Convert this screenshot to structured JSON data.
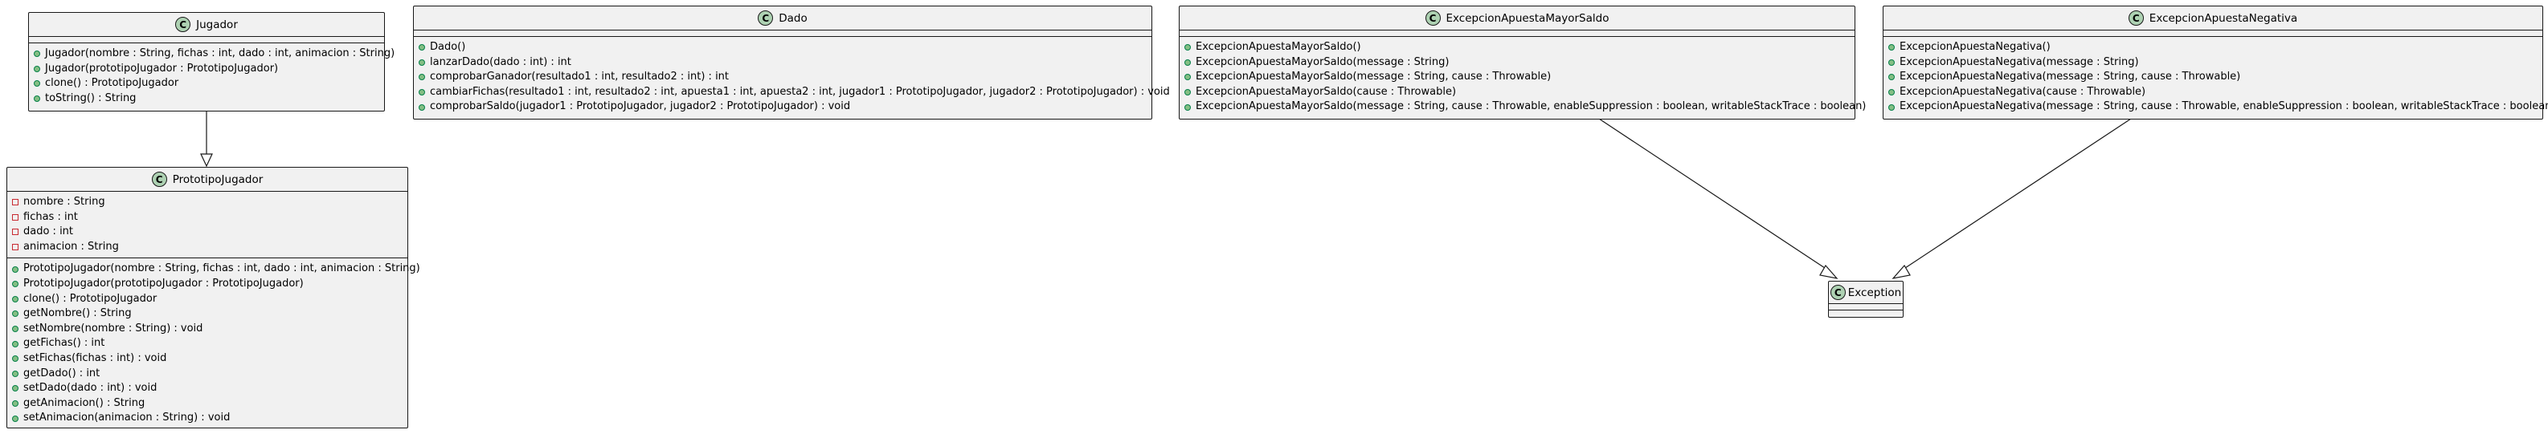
{
  "diagram": {
    "classes": {
      "jugador": {
        "name": "Jugador",
        "stereotype_letter": "C",
        "fields": [],
        "methods": [
          {
            "vis": "public",
            "text": "Jugador(nombre : String, fichas : int, dado : int, animacion : String)"
          },
          {
            "vis": "public",
            "text": "Jugador(prototipoJugador : PrototipoJugador)"
          },
          {
            "vis": "public",
            "text": "clone() : PrototipoJugador"
          },
          {
            "vis": "public",
            "text": "toString() : String"
          }
        ]
      },
      "prototipo": {
        "name": "PrototipoJugador",
        "stereotype_letter": "C",
        "fields": [
          {
            "vis": "private",
            "text": "nombre : String"
          },
          {
            "vis": "private",
            "text": "fichas : int"
          },
          {
            "vis": "private",
            "text": "dado : int"
          },
          {
            "vis": "private",
            "text": "animacion : String"
          }
        ],
        "methods": [
          {
            "vis": "public",
            "text": "PrototipoJugador(nombre : String, fichas : int, dado : int, animacion : String)"
          },
          {
            "vis": "public",
            "text": "PrototipoJugador(prototipoJugador : PrototipoJugador)"
          },
          {
            "vis": "public",
            "text": "clone() : PrototipoJugador"
          },
          {
            "vis": "public",
            "text": "getNombre() : String"
          },
          {
            "vis": "public",
            "text": "setNombre(nombre : String) : void"
          },
          {
            "vis": "public",
            "text": "getFichas() : int"
          },
          {
            "vis": "public",
            "text": "setFichas(fichas : int) : void"
          },
          {
            "vis": "public",
            "text": "getDado() : int"
          },
          {
            "vis": "public",
            "text": "setDado(dado : int) : void"
          },
          {
            "vis": "public",
            "text": "getAnimacion() : String"
          },
          {
            "vis": "public",
            "text": "setAnimacion(animacion : String) : void"
          }
        ]
      },
      "dado": {
        "name": "Dado",
        "stereotype_letter": "C",
        "fields": [],
        "methods": [
          {
            "vis": "public",
            "text": "Dado()"
          },
          {
            "vis": "public",
            "text": "lanzarDado(dado : int) : int"
          },
          {
            "vis": "public",
            "text": "comprobarGanador(resultado1 : int, resultado2 : int) : int"
          },
          {
            "vis": "public",
            "text": "cambiarFichas(resultado1 : int, resultado2 : int, apuesta1 : int, apuesta2 : int, jugador1 : PrototipoJugador, jugador2 : PrototipoJugador) : void"
          },
          {
            "vis": "public",
            "text": "comprobarSaldo(jugador1 : PrototipoJugador, jugador2 : PrototipoJugador) : void"
          }
        ]
      },
      "mayor": {
        "name": "ExcepcionApuestaMayorSaldo",
        "stereotype_letter": "C",
        "fields": [],
        "methods": [
          {
            "vis": "public",
            "text": "ExcepcionApuestaMayorSaldo()"
          },
          {
            "vis": "public",
            "text": "ExcepcionApuestaMayorSaldo(message : String)"
          },
          {
            "vis": "public",
            "text": "ExcepcionApuestaMayorSaldo(message : String, cause : Throwable)"
          },
          {
            "vis": "public",
            "text": "ExcepcionApuestaMayorSaldo(cause : Throwable)"
          },
          {
            "vis": "public",
            "text": "ExcepcionApuestaMayorSaldo(message : String, cause : Throwable, enableSuppression : boolean, writableStackTrace : boolean)"
          }
        ]
      },
      "negativa": {
        "name": "ExcepcionApuestaNegativa",
        "stereotype_letter": "C",
        "fields": [],
        "methods": [
          {
            "vis": "public",
            "text": "ExcepcionApuestaNegativa()"
          },
          {
            "vis": "public",
            "text": "ExcepcionApuestaNegativa(message : String)"
          },
          {
            "vis": "public",
            "text": "ExcepcionApuestaNegativa(message : String, cause : Throwable)"
          },
          {
            "vis": "public",
            "text": "ExcepcionApuestaNegativa(cause : Throwable)"
          },
          {
            "vis": "public",
            "text": "ExcepcionApuestaNegativa(message : String, cause : Throwable, enableSuppression : boolean, writableStackTrace : boolean)"
          }
        ]
      },
      "exception": {
        "name": "Exception",
        "stereotype_letter": "C",
        "fields": [],
        "methods": []
      }
    },
    "relations": [
      {
        "from": "Jugador",
        "to": "PrototipoJugador",
        "kind": "generalization"
      },
      {
        "from": "ExcepcionApuestaMayorSaldo",
        "to": "Exception",
        "kind": "generalization"
      },
      {
        "from": "ExcepcionApuestaNegativa",
        "to": "Exception",
        "kind": "generalization"
      }
    ],
    "colors": {
      "class_fill": "#f1f1f1",
      "border": "#181818",
      "badge_fill": "#add1b2",
      "public_marker": "#84be84",
      "private_marker": "#c82930"
    }
  }
}
